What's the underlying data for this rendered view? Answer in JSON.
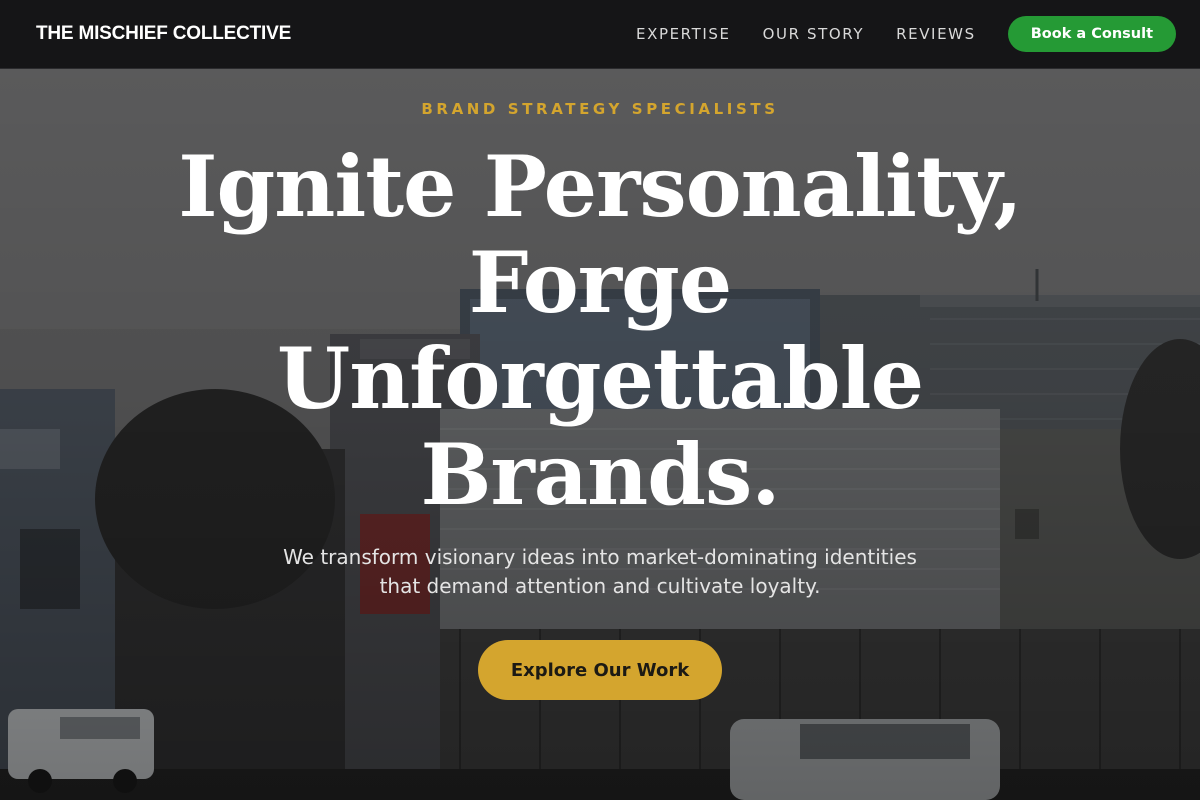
{
  "navbar": {
    "brand": "THE MISCHIEF COLLECTIVE",
    "links": [
      "EXPERTISE",
      "OUR STORY",
      "REVIEWS"
    ],
    "cta_label": "Book a Consult"
  },
  "hero": {
    "eyebrow": "BRAND STRATEGY SPECIALISTS",
    "headline_lines": [
      "Ignite Personality,",
      "Forge",
      "Unforgettable",
      "Brands."
    ],
    "subhead_lines": [
      "We transform visionary ideas into market-dominating identities",
      "that demand attention and cultivate loyalty."
    ],
    "cta_label": "Explore Our Work"
  },
  "colors": {
    "nav_background": "#151517",
    "accent_gold": "#d4a52e",
    "cta_green": "#259a35"
  }
}
